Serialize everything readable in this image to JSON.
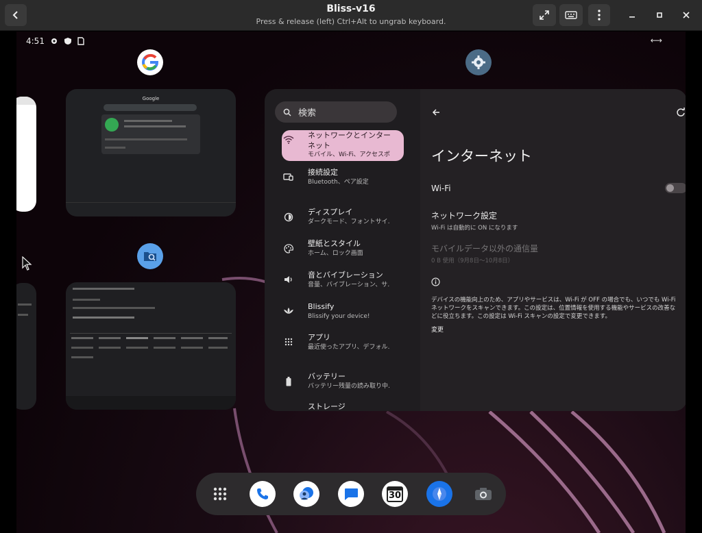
{
  "window": {
    "title": "Bliss-v16",
    "subtitle": "Press & release (left) Ctrl+Alt to ungrab keyboard."
  },
  "statusbar": {
    "time": "4:51"
  },
  "recents": {
    "google_thumb": {
      "brand": "Google"
    },
    "files_thumb": {}
  },
  "settings": {
    "search_placeholder": "検索",
    "menu": [
      {
        "title": "ネットワークとインターネット",
        "sub": "モバイル、Wi-Fi、アクセスポ…",
        "icon": "wifi-icon"
      },
      {
        "title": "接続設定",
        "sub": "Bluetooth、ペア設定",
        "icon": "devices-icon"
      },
      {
        "title": "ディスプレイ",
        "sub": "ダークモード、フォントサイ…",
        "icon": "brightness-icon"
      },
      {
        "title": "壁紙とスタイル",
        "sub": "ホーム、ロック画面",
        "icon": "palette-icon"
      },
      {
        "title": "音とバイブレーション",
        "sub": "音量、バイブレーション、サ…",
        "icon": "volume-icon"
      },
      {
        "title": "Blissify",
        "sub": "Blissify your device!",
        "icon": "lotus-icon"
      },
      {
        "title": "アプリ",
        "sub": "最近使ったアプリ、デフォル…",
        "icon": "apps-grid-icon"
      },
      {
        "title": "バッテリー",
        "sub": "バッテリー残量の読み取り中…",
        "icon": "battery-icon"
      },
      {
        "title": "ストレージ",
        "sub": "",
        "icon": "storage-icon"
      }
    ],
    "detail": {
      "title": "インターネット",
      "wifi_label": "Wi-Fi",
      "network_settings_title": "ネットワーク設定",
      "network_settings_sub": "Wi-Fi は自動的に ON になります",
      "non_carrier_title": "モバイルデータ以外の通信量",
      "non_carrier_sub": "0 B 使用（9月8日〜10月8日）",
      "info_text": "デバイスの機能向上のため、アプリやサービスは、Wi-Fi が OFF の場合でも、いつでも Wi-Fi ネットワークをスキャンできます。この設定は、位置情報を使用する機能やサービスの改善などに役立ちます。この設定は Wi-Fi スキャンの設定で変更できます。",
      "change_link": "変更"
    }
  },
  "dock": {
    "calendar_day": "30"
  },
  "colors": {
    "accent_pink": "#e8b9d2",
    "wallpaper_curve": "#8a5a7e"
  }
}
